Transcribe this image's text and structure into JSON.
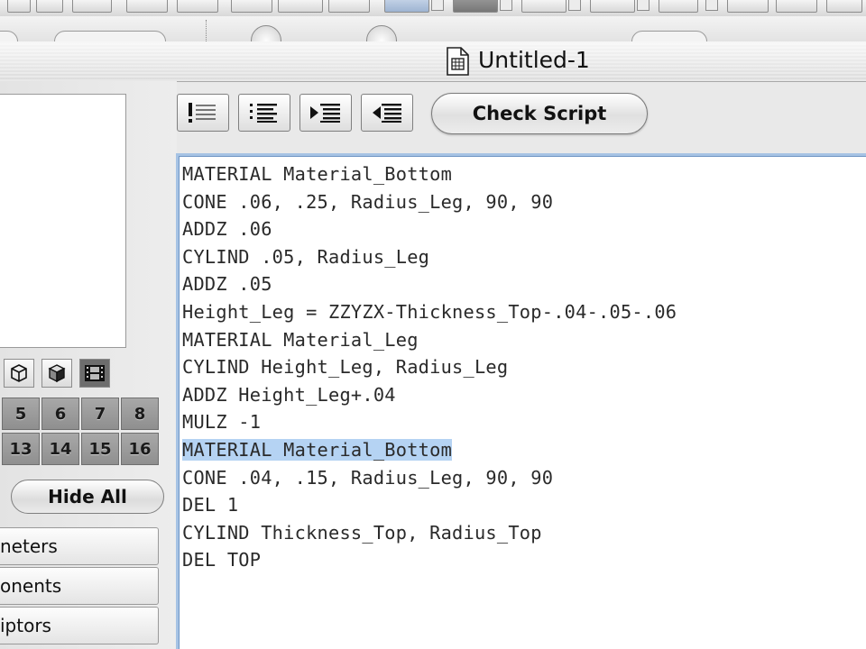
{
  "window": {
    "title": "Untitled-1"
  },
  "toolbar": {
    "check_script_label": "Check Script"
  },
  "left_panel": {
    "layer_numbers": [
      "5",
      "6",
      "7",
      "8",
      "13",
      "14",
      "15",
      "16"
    ],
    "hide_all_label": "Hide All",
    "tabs": [
      "neters",
      "onents",
      "iptors"
    ]
  },
  "editor": {
    "lines": [
      "MATERIAL Material_Bottom",
      "CONE .06, .25, Radius_Leg, 90, 90",
      "ADDZ .06",
      "CYLIND .05, Radius_Leg",
      "ADDZ .05",
      "Height_Leg = ZZYZX-Thickness_Top-.04-.05-.06",
      "MATERIAL Material_Leg",
      "CYLIND Height_Leg, Radius_Leg",
      "ADDZ Height_Leg+.04",
      "MULZ -1",
      "MATERIAL Material_Bottom",
      "CONE .04, .15, Radius_Leg, 90, 90",
      "DEL 1",
      "CYLIND Thickness_Top, Radius_Top",
      "DEL TOP"
    ],
    "selected_line_index": 10
  },
  "colors": {
    "selection": "#b5d3f3",
    "focus_ring": "#a6c3e4"
  }
}
